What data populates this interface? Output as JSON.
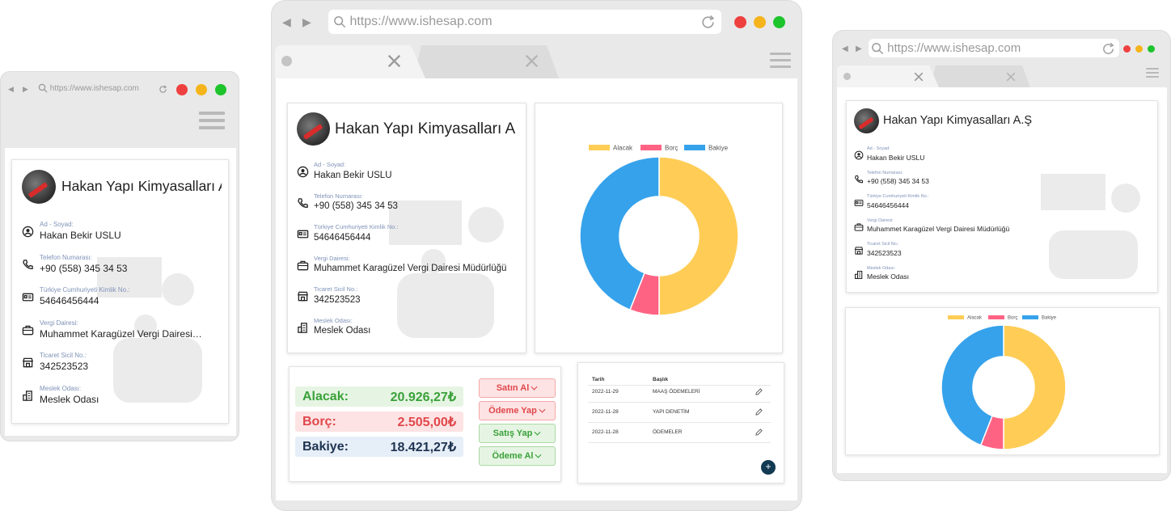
{
  "browser": {
    "url": "https://www.ishesap.com"
  },
  "company": {
    "title_medium": "Hakan Yapı Kimyasalları A",
    "title_small": "Hakan Yapı Kimyasalları A",
    "title_large": "Hakan Yapı Kimyasalları A.Ş"
  },
  "details": [
    {
      "icon": "user-circle-icon",
      "label": "Ad - Soyad:",
      "value": "Hakan Bekir USLU"
    },
    {
      "icon": "phone-icon",
      "label": "Telefon Numarası:",
      "value": "+90 (558) 345 34 53"
    },
    {
      "icon": "id-card-icon",
      "label": "Türkiye Cumhuriyeti Kimlik No.:",
      "value": "54646456444"
    },
    {
      "icon": "briefcase-icon",
      "label": "Vergi Dairesi:",
      "value": "Muhammet Karagüzel Vergi Dairesi Müdürlüğü"
    },
    {
      "icon": "store-icon",
      "label": "Ticaret Sicil No.:",
      "value": "342523523"
    },
    {
      "icon": "building-icon",
      "label": "Meslek Odası:",
      "value": "Meslek Odası"
    }
  ],
  "small_tax_office": "Muhammet Karagüzel Vergi Dairesi…",
  "chart_data": {
    "type": "pie",
    "subtype": "doughnut",
    "labels": [
      "Alacak",
      "Borç",
      "Bakiye"
    ],
    "values": [
      20926.27,
      2505.0,
      18421.27
    ],
    "colors": [
      "#ffcd56",
      "#ff6384",
      "#36a2eb"
    ],
    "legend": "top"
  },
  "balances": [
    {
      "label": "Alacak:",
      "value": "20.926,27₺",
      "color": "#3aa13a",
      "bg": "#e6f5e3"
    },
    {
      "label": "Borç:",
      "value": "2.505,00₺",
      "color": "#e0474c",
      "bg": "#fde3e3"
    },
    {
      "label": "Bakiye:",
      "value": "18.421,27₺",
      "color": "#1e3350",
      "bg": "#e6eef8"
    }
  ],
  "actions": [
    {
      "label": "Satın Al",
      "color": "#e0474c",
      "bg": "#fde3e3",
      "border": "#f2a9a9"
    },
    {
      "label": "Ödeme Yap",
      "color": "#e0474c",
      "bg": "#fde3e3",
      "border": "#f2a9a9"
    },
    {
      "label": "Satış Yap",
      "color": "#3aa13a",
      "bg": "#e6f5e3",
      "border": "#a9d9a3"
    },
    {
      "label": "Ödeme Al",
      "color": "#3aa13a",
      "bg": "#e6f5e3",
      "border": "#a9d9a3"
    }
  ],
  "table": {
    "headers": [
      "Tarih",
      "Başlık"
    ],
    "rows": [
      {
        "date": "2022-11-29",
        "title": "MAAŞ ÖDEMELERİ"
      },
      {
        "date": "2022-11-28",
        "title": "YAPI DENETİM"
      },
      {
        "date": "2022-11-28",
        "title": "ÖDEMELER"
      }
    ],
    "add_label": "+"
  }
}
